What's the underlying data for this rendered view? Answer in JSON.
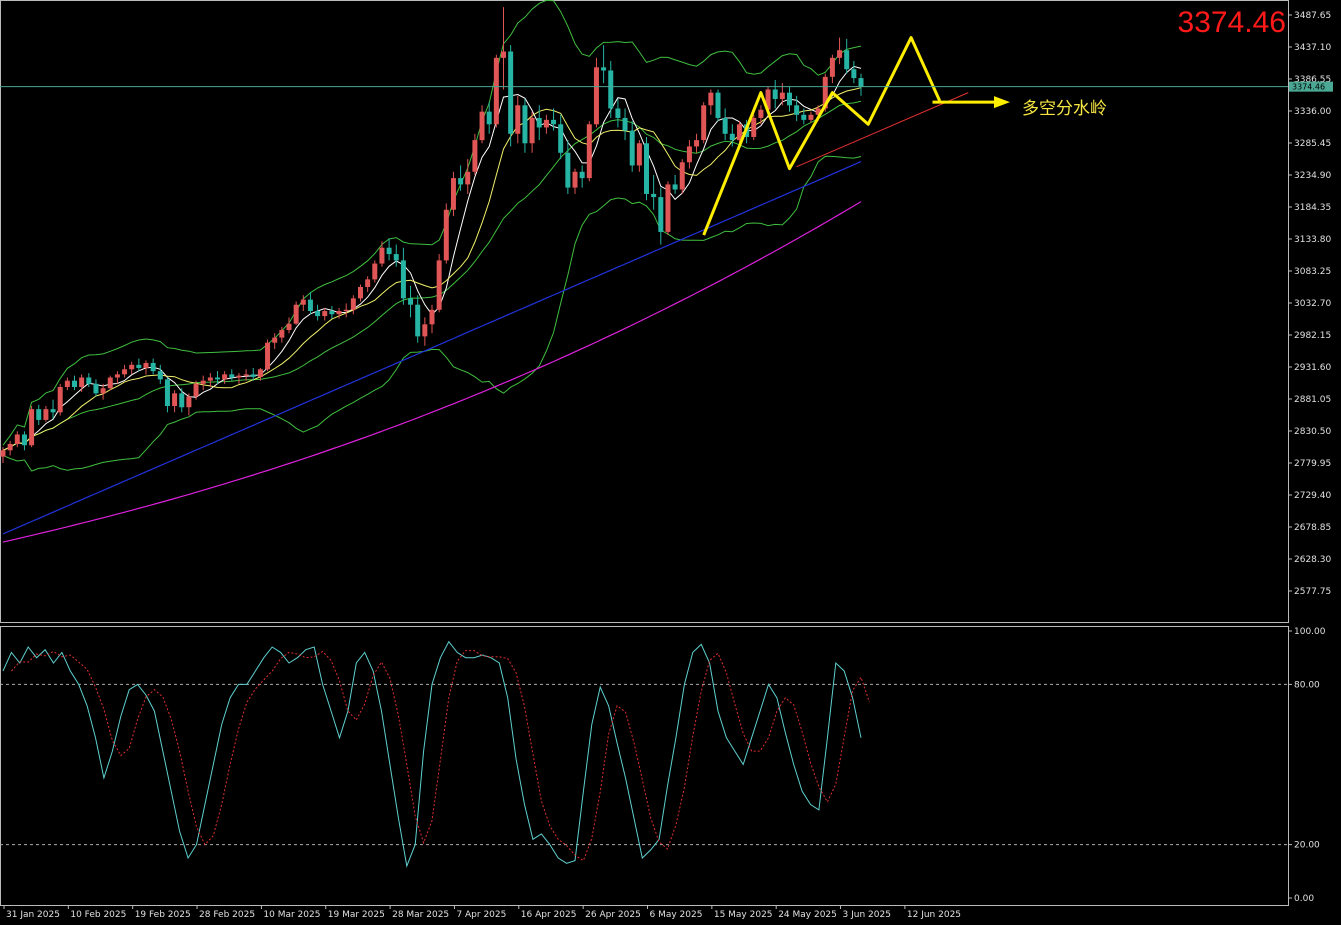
{
  "current_price": "3374.46",
  "annotation": "多空分水岭",
  "chart_data": [
    {
      "type": "candlestick",
      "title": "",
      "ylim": [
        2540,
        3510
      ],
      "price_ticks": [
        "3487.65",
        "3437.10",
        "3386.55",
        "3336.00",
        "3285.45",
        "3234.90",
        "3184.35",
        "3133.80",
        "3083.25",
        "3032.70",
        "2982.15",
        "2931.60",
        "2881.05",
        "2830.50",
        "2779.95",
        "2729.40",
        "2678.85",
        "2628.30",
        "2577.75"
      ],
      "date_labels": [
        "31 Jan 2025",
        "10 Feb 2025",
        "19 Feb 2025",
        "28 Feb 2025",
        "10 Mar 2025",
        "19 Mar 2025",
        "28 Mar 2025",
        "7 Apr 2025",
        "16 Apr 2025",
        "26 Apr 2025",
        "6 May 2025",
        "15 May 2025",
        "24 May 2025",
        "3 Jun 2025",
        "12 Jun 2025"
      ],
      "horizontal_line": 3374.46,
      "colors": {
        "bull": "#e05555",
        "bear": "#26b5a5",
        "bb": "#3fbf3f",
        "ma_fast": "#ffffff",
        "ma_mid": "#f0f06a",
        "ma_blue": "#2233dd",
        "ma_magenta": "#dd22dd",
        "hline": "#4aa894",
        "zigzag": "#ffee00"
      },
      "ohlc": [
        [
          2790,
          2805,
          2780,
          2800
        ],
        [
          2800,
          2815,
          2792,
          2810
        ],
        [
          2810,
          2830,
          2805,
          2825
        ],
        [
          2825,
          2830,
          2800,
          2808
        ],
        [
          2808,
          2870,
          2805,
          2865
        ],
        [
          2865,
          2872,
          2840,
          2848
        ],
        [
          2848,
          2870,
          2845,
          2865
        ],
        [
          2865,
          2880,
          2850,
          2860
        ],
        [
          2860,
          2905,
          2855,
          2900
        ],
        [
          2900,
          2915,
          2895,
          2910
        ],
        [
          2910,
          2918,
          2895,
          2900
        ],
        [
          2900,
          2920,
          2892,
          2915
        ],
        [
          2915,
          2922,
          2900,
          2905
        ],
        [
          2905,
          2912,
          2885,
          2890
        ],
        [
          2890,
          2905,
          2880,
          2898
        ],
        [
          2898,
          2918,
          2895,
          2915
        ],
        [
          2915,
          2925,
          2905,
          2920
        ],
        [
          2920,
          2935,
          2915,
          2928
        ],
        [
          2928,
          2940,
          2920,
          2935
        ],
        [
          2935,
          2945,
          2925,
          2930
        ],
        [
          2930,
          2942,
          2920,
          2938
        ],
        [
          2938,
          2945,
          2920,
          2925
        ],
        [
          2925,
          2935,
          2905,
          2912
        ],
        [
          2912,
          2915,
          2860,
          2870
        ],
        [
          2870,
          2895,
          2860,
          2890
        ],
        [
          2890,
          2898,
          2860,
          2868
        ],
        [
          2868,
          2890,
          2855,
          2885
        ],
        [
          2885,
          2910,
          2880,
          2905
        ],
        [
          2905,
          2918,
          2895,
          2910
        ],
        [
          2910,
          2922,
          2900,
          2915
        ],
        [
          2915,
          2925,
          2905,
          2912
        ],
        [
          2912,
          2925,
          2905,
          2920
        ],
        [
          2920,
          2928,
          2910,
          2915
        ],
        [
          2915,
          2922,
          2905,
          2918
        ],
        [
          2918,
          2928,
          2910,
          2920
        ],
        [
          2920,
          2930,
          2910,
          2916
        ],
        [
          2916,
          2930,
          2910,
          2928
        ],
        [
          2928,
          2975,
          2925,
          2970
        ],
        [
          2970,
          2985,
          2960,
          2978
        ],
        [
          2978,
          2995,
          2970,
          2990
        ],
        [
          2990,
          3010,
          2985,
          3000
        ],
        [
          3000,
          3035,
          2998,
          3030
        ],
        [
          3030,
          3045,
          3020,
          3038
        ],
        [
          3038,
          3050,
          3015,
          3020
        ],
        [
          3020,
          3030,
          3005,
          3012
        ],
        [
          3012,
          3025,
          3005,
          3020
        ],
        [
          3020,
          3028,
          3008,
          3015
        ],
        [
          3015,
          3025,
          3008,
          3020
        ],
        [
          3020,
          3032,
          3010,
          3022
        ],
        [
          3022,
          3045,
          3015,
          3040
        ],
        [
          3040,
          3062,
          3035,
          3058
        ],
        [
          3058,
          3075,
          3050,
          3070
        ],
        [
          3070,
          3100,
          3065,
          3095
        ],
        [
          3095,
          3130,
          3090,
          3120
        ],
        [
          3120,
          3135,
          3100,
          3110
        ],
        [
          3110,
          3125,
          3090,
          3100
        ],
        [
          3100,
          3120,
          3030,
          3040
        ],
        [
          3040,
          3060,
          3010,
          3030
        ],
        [
          3030,
          3045,
          2970,
          2980
        ],
        [
          2980,
          3010,
          2965,
          2999
        ],
        [
          2999,
          3030,
          2985,
          3022
        ],
        [
          3022,
          3110,
          3018,
          3100
        ],
        [
          3100,
          3190,
          3095,
          3180
        ],
        [
          3180,
          3240,
          3170,
          3230
        ],
        [
          3230,
          3250,
          3210,
          3220
        ],
        [
          3220,
          3260,
          3205,
          3240
        ],
        [
          3240,
          3300,
          3235,
          3290
        ],
        [
          3290,
          3345,
          3285,
          3335
        ],
        [
          3335,
          3350,
          3300,
          3315
        ],
        [
          3315,
          3425,
          3310,
          3420
        ],
        [
          3420,
          3500,
          3370,
          3430
        ],
        [
          3430,
          3440,
          3280,
          3300
        ],
        [
          3300,
          3360,
          3285,
          3345
        ],
        [
          3345,
          3355,
          3270,
          3285
        ],
        [
          3285,
          3335,
          3270,
          3325
        ],
        [
          3325,
          3345,
          3290,
          3310
        ],
        [
          3310,
          3330,
          3300,
          3322
        ],
        [
          3322,
          3340,
          3305,
          3315
        ],
        [
          3315,
          3330,
          3260,
          3270
        ],
        [
          3270,
          3290,
          3205,
          3215
        ],
        [
          3215,
          3245,
          3205,
          3240
        ],
        [
          3240,
          3250,
          3215,
          3230
        ],
        [
          3230,
          3320,
          3225,
          3315
        ],
        [
          3315,
          3420,
          3310,
          3405
        ],
        [
          3405,
          3440,
          3380,
          3400
        ],
        [
          3400,
          3415,
          3325,
          3340
        ],
        [
          3340,
          3355,
          3310,
          3325
        ],
        [
          3325,
          3340,
          3290,
          3305
        ],
        [
          3305,
          3320,
          3240,
          3250
        ],
        [
          3250,
          3290,
          3240,
          3285
        ],
        [
          3285,
          3295,
          3195,
          3205
        ],
        [
          3205,
          3235,
          3180,
          3200
        ],
        [
          3200,
          3215,
          3125,
          3145
        ],
        [
          3145,
          3225,
          3140,
          3220
        ],
        [
          3220,
          3235,
          3205,
          3212
        ],
        [
          3212,
          3260,
          3205,
          3255
        ],
        [
          3255,
          3290,
          3245,
          3280
        ],
        [
          3280,
          3300,
          3270,
          3290
        ],
        [
          3290,
          3350,
          3285,
          3345
        ],
        [
          3345,
          3370,
          3330,
          3365
        ],
        [
          3365,
          3370,
          3320,
          3325
        ],
        [
          3325,
          3340,
          3290,
          3300
        ],
        [
          3300,
          3315,
          3280,
          3290
        ],
        [
          3290,
          3320,
          3280,
          3315
        ],
        [
          3315,
          3322,
          3285,
          3295
        ],
        [
          3295,
          3330,
          3290,
          3325
        ],
        [
          3325,
          3345,
          3315,
          3338
        ],
        [
          3338,
          3375,
          3330,
          3370
        ],
        [
          3370,
          3385,
          3340,
          3355
        ],
        [
          3355,
          3380,
          3345,
          3365
        ],
        [
          3365,
          3375,
          3335,
          3345
        ],
        [
          3345,
          3360,
          3320,
          3330
        ],
        [
          3330,
          3340,
          3315,
          3322
        ],
        [
          3322,
          3335,
          3318,
          3330
        ],
        [
          3330,
          3345,
          3320,
          3340
        ],
        [
          3340,
          3395,
          3335,
          3390
        ],
        [
          3390,
          3425,
          3380,
          3420
        ],
        [
          3420,
          3452,
          3410,
          3432
        ],
        [
          3432,
          3450,
          3395,
          3402
        ],
        [
          3402,
          3415,
          3380,
          3388
        ],
        [
          3388,
          3395,
          3360,
          3374.46
        ]
      ],
      "stochastic": {
        "ylim": [
          0,
          100
        ],
        "levels": [
          80,
          20
        ],
        "ticks": [
          "100.00",
          "80.00",
          "20.00",
          "0.00"
        ],
        "k": [
          85,
          92,
          88,
          94,
          90,
          93,
          88,
          92,
          85,
          80,
          72,
          60,
          45,
          55,
          68,
          78,
          80,
          76,
          70,
          55,
          40,
          25,
          15,
          20,
          35,
          50,
          65,
          75,
          80,
          80,
          85,
          90,
          94,
          92,
          88,
          90,
          93,
          94,
          80,
          70,
          60,
          70,
          88,
          92,
          85,
          70,
          50,
          30,
          12,
          20,
          55,
          80,
          90,
          96,
          92,
          90,
          90,
          91,
          90,
          88,
          75,
          52,
          35,
          22,
          24,
          20,
          15,
          13,
          14,
          40,
          65,
          79,
          72,
          58,
          45,
          30,
          15,
          18,
          22,
          42,
          60,
          80,
          92,
          95,
          88,
          70,
          60,
          55,
          50,
          60,
          70,
          80,
          75,
          62,
          50,
          40,
          35,
          33,
          60,
          88,
          85,
          75,
          60
        ]
      }
    }
  ]
}
